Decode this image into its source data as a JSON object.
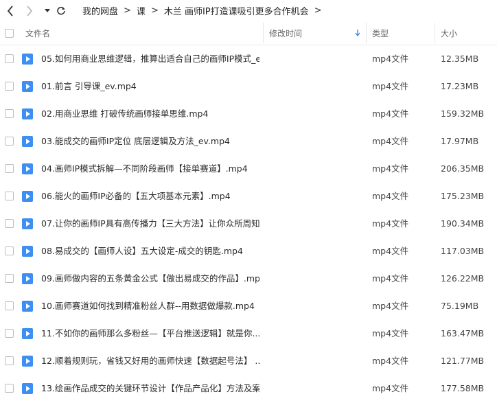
{
  "breadcrumb": [
    "我的网盘",
    "课",
    "木兰 画师IP打造课吸引更多合作机会"
  ],
  "columns": {
    "name": "文件名",
    "modified": "修改时间",
    "type": "类型",
    "size": "大小"
  },
  "files": [
    {
      "name": "05.如何用商业思维逻辑，推算出适合自己的画师IP模式_e...",
      "type": "mp4文件",
      "size": "12.35MB"
    },
    {
      "name": "01.前言 引导课_ev.mp4",
      "type": "mp4文件",
      "size": "17.23MB"
    },
    {
      "name": "02.用商业思维 打破传统画师接单思维.mp4",
      "type": "mp4文件",
      "size": "159.32MB"
    },
    {
      "name": "03.能成交的画师IP定位 底层逻辑及方法_ev.mp4",
      "type": "mp4文件",
      "size": "17.97MB"
    },
    {
      "name": "04.画师IP模式拆解—不同阶段画师【接单赛道】.mp4",
      "type": "mp4文件",
      "size": "206.35MB"
    },
    {
      "name": "06.能火的画师IP必备的【五大项基本元素】.mp4",
      "type": "mp4文件",
      "size": "175.23MB"
    },
    {
      "name": "07.让你的画师IP具有高传播力【三大方法】让你众所周知...",
      "type": "mp4文件",
      "size": "190.34MB"
    },
    {
      "name": "08.易成交的【画师人设】五大设定-成交的钥匙.mp4",
      "type": "mp4文件",
      "size": "117.03MB"
    },
    {
      "name": "09.画师做内容的五条黄金公式【做出易成交的作品】.mp4",
      "type": "mp4文件",
      "size": "126.22MB"
    },
    {
      "name": "10.画师赛道如何找到精准粉丝人群--用数据做爆款.mp4",
      "type": "mp4文件",
      "size": "75.19MB"
    },
    {
      "name": "11.不如你的画师那么多粉丝—【平台推送逻辑】就是你...",
      "type": "mp4文件",
      "size": "163.47MB"
    },
    {
      "name": "12.顺着规则玩，省钱又好用的画师快速【数据起号法】 ...",
      "type": "mp4文件",
      "size": "121.77MB"
    },
    {
      "name": "13.绘画作品成交的关键环节设计【作品产品化】方法及案...",
      "type": "mp4文件",
      "size": "177.58MB"
    }
  ]
}
